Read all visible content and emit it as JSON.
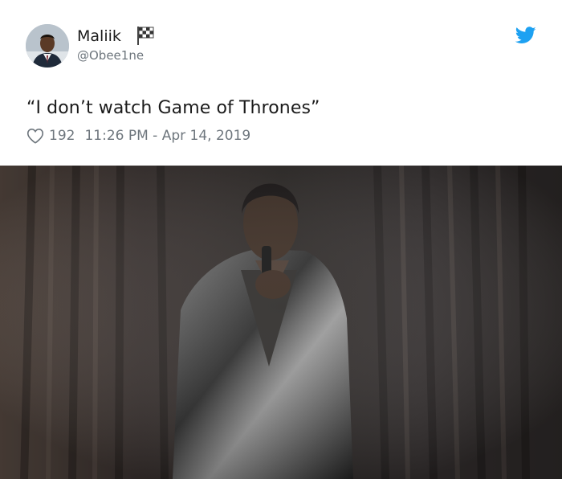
{
  "tweet": {
    "display_name": "Maliik",
    "display_name_emoji": "checkered-flag-icon",
    "handle": "@Obee1ne",
    "text": "“I don’t watch Game of Thrones”",
    "likes": "192",
    "timestamp": "11:26 PM - Apr 14, 2019"
  },
  "icons": {
    "brand": "twitter-bird-icon",
    "like": "heart-outline-icon"
  },
  "colors": {
    "brand_blue": "#1DA1F2",
    "secondary_text": "#6e767d",
    "primary_text": "#1b1b1b"
  },
  "media": {
    "description_icon": "stand-up-comedian-image"
  }
}
